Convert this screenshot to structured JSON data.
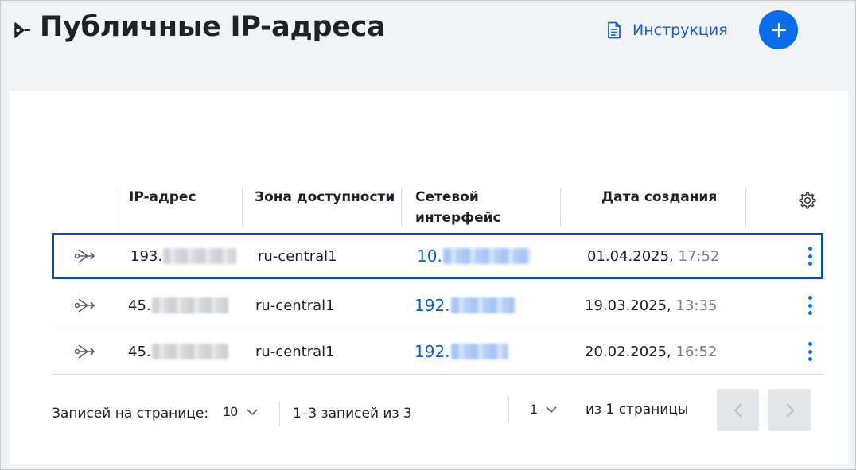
{
  "header": {
    "title": "Публичные IP-адреса",
    "icon": "public-ip-icon",
    "docs_label": "Инструкция",
    "docs_icon": "document-icon",
    "add_icon": "plus-icon"
  },
  "colors": {
    "accent": "#0a6ce8",
    "link": "#1060d0",
    "selected_border": "#0f4fa8",
    "background": "#f2f3f5",
    "card": "#ffffff"
  },
  "table": {
    "columns": [
      "IP-адрес",
      "Зона доступности",
      "Сетевой интерфейс",
      "Дата создания"
    ],
    "settings_icon": "gear-icon",
    "rows": [
      {
        "ip": "193.",
        "zone": "ru-central1",
        "nic": "10.",
        "date": "01.04.2025,",
        "time": "17:52",
        "selected": true,
        "icon": "public-ip-icon"
      },
      {
        "ip": "45.",
        "zone": "ru-central1",
        "nic": "192.",
        "date": "19.03.2025,",
        "time": "13:35",
        "selected": false,
        "icon": "public-ip-icon"
      },
      {
        "ip": "45.",
        "zone": "ru-central1",
        "nic": "192.",
        "date": "20.02.2025,",
        "time": "16:52",
        "selected": false,
        "icon": "public-ip-icon"
      }
    ]
  },
  "pagination": {
    "per_page_label": "Записей на странице:",
    "per_page_value": "10",
    "range_label": "1–3 записей из 3",
    "page_value": "1",
    "of_pages_label": "из 1 страницы",
    "prev_icon": "chevron-left-icon",
    "next_icon": "chevron-right-icon"
  }
}
